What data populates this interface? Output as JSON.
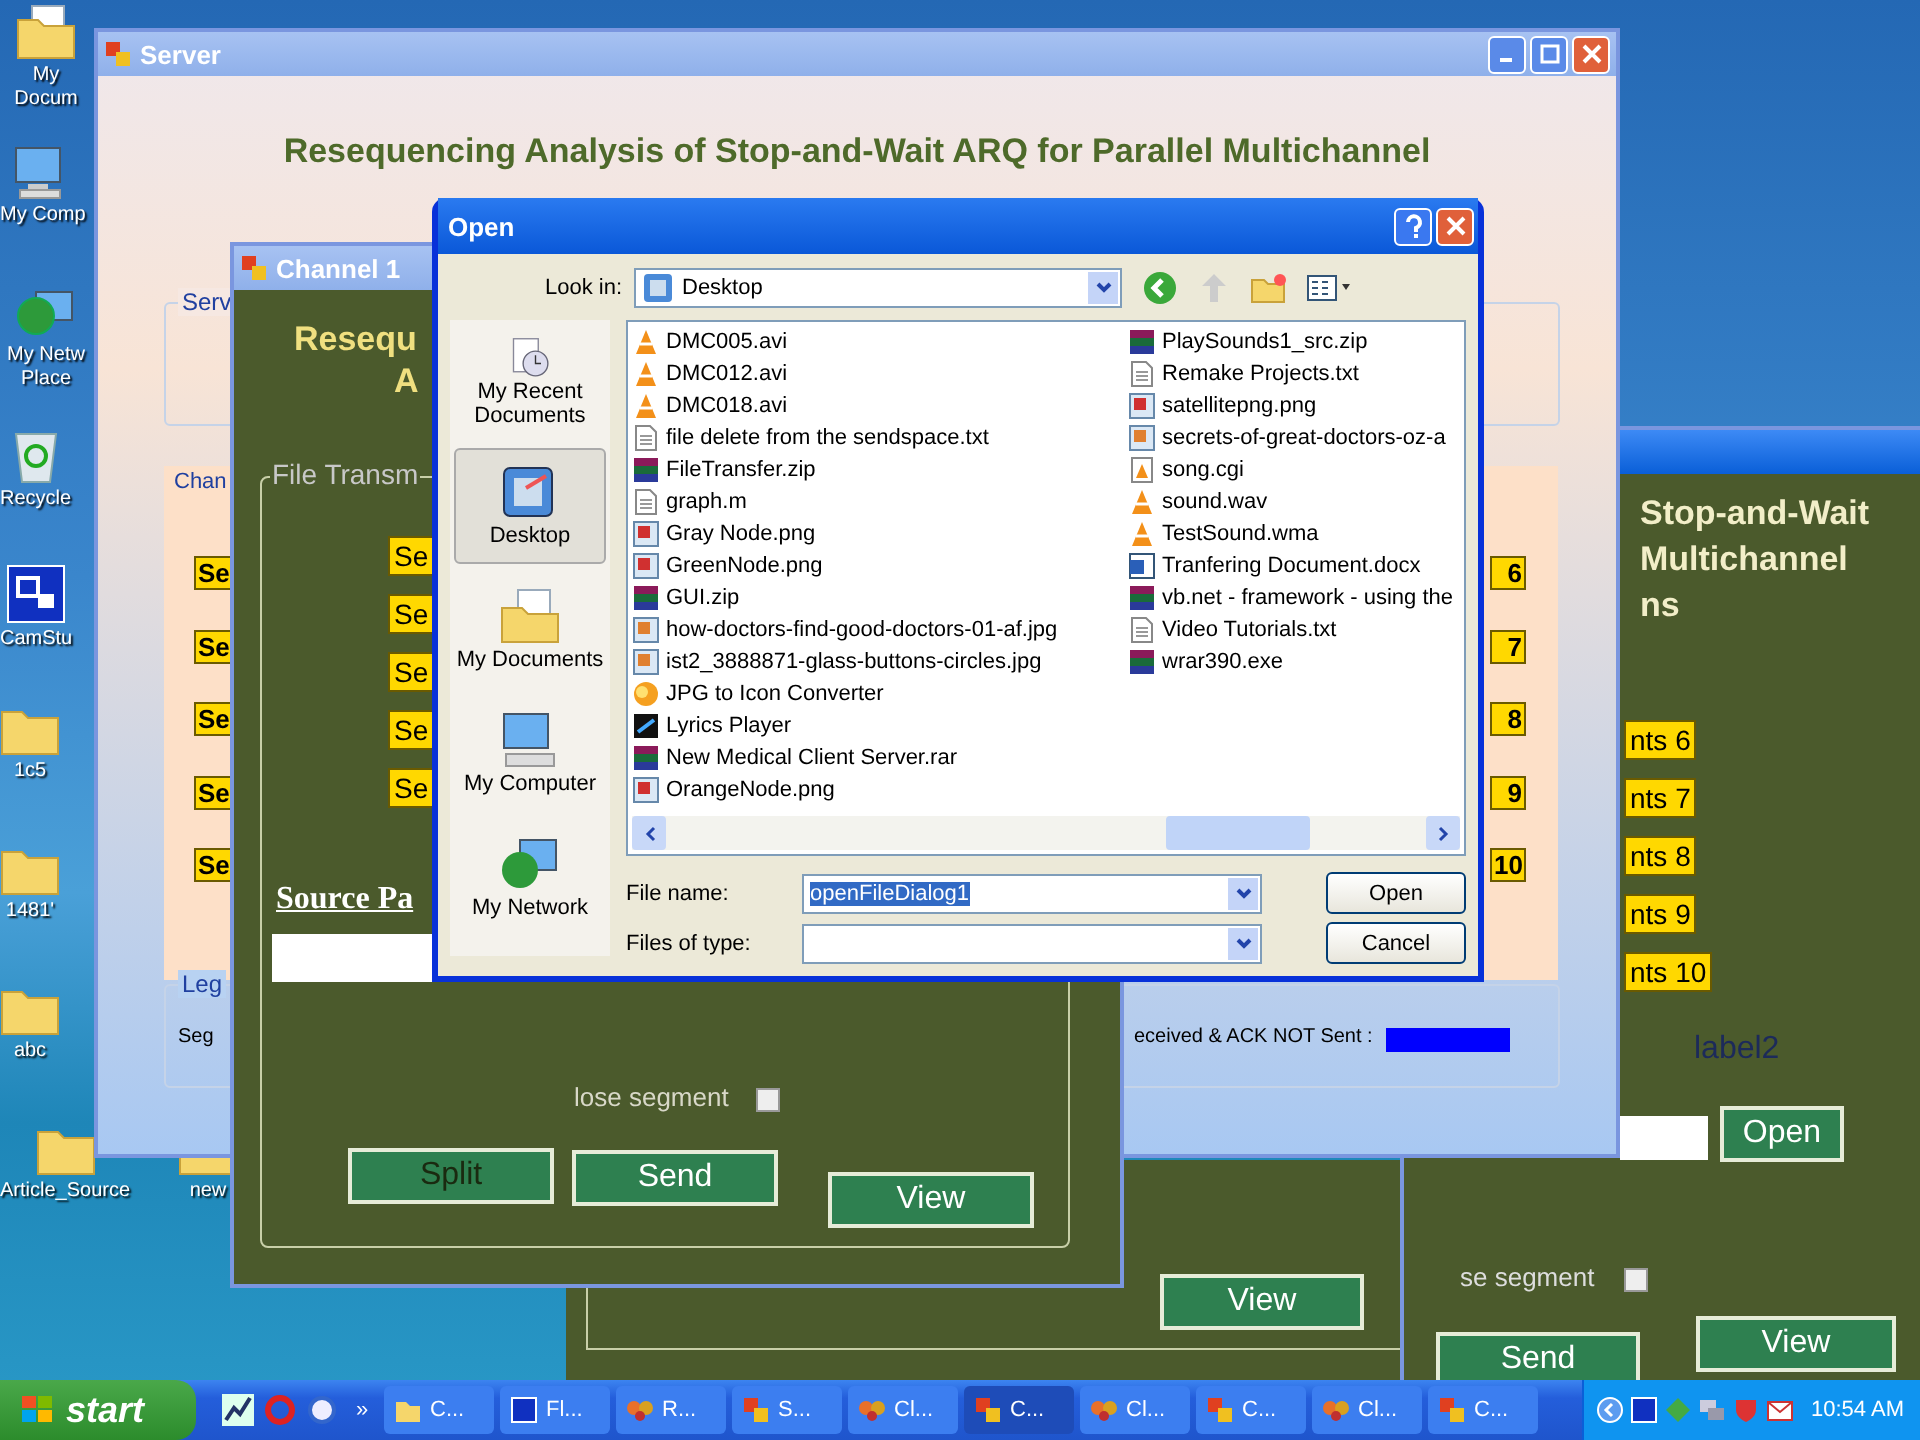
{
  "desktop": {
    "icons": [
      {
        "label": "My Docum",
        "kind": "documents"
      },
      {
        "label": "My Comp",
        "kind": "computer"
      },
      {
        "label": "My Netw Place",
        "kind": "network"
      },
      {
        "label": "Recycle",
        "kind": "recycle"
      },
      {
        "label": "CamStu",
        "kind": "shortcut"
      },
      {
        "label": "1c5",
        "kind": "folder"
      },
      {
        "label": "1481'",
        "kind": "folder"
      },
      {
        "label": "abc",
        "kind": "folder"
      },
      {
        "label": "Article_Source",
        "kind": "folder"
      },
      {
        "label": "new",
        "kind": "folder"
      }
    ]
  },
  "right_window": {
    "heading_lines": [
      "Stop-and-Wait",
      "Multichannel",
      "ns"
    ],
    "segment_labels": [
      "nts 6",
      "nts 7",
      "nts 8",
      "nts 9",
      "nts 10"
    ],
    "label2": "label2",
    "open_button": "Open",
    "lose_segment": {
      "label": "se segment",
      "checked": false
    },
    "buttons": [
      "Send",
      "View"
    ]
  },
  "lower_window": {
    "buttons": [
      "View"
    ]
  },
  "server_window": {
    "title": "Server",
    "heading": "Resequencing Analysis of Stop-and-Wait ARQ for Parallel Multichannel",
    "server_group": {
      "label": "Serv"
    },
    "channels_group": {
      "label": "Chan",
      "left_labels": [
        "Se",
        "Se",
        "Se",
        "Se",
        "Se"
      ],
      "right_labels": [
        "6",
        "7",
        "8",
        "9",
        "10"
      ]
    },
    "legend": {
      "label": "Leg",
      "items": [
        {
          "text": "Seg"
        },
        {
          "text": "eceived & ACK NOT Sent :",
          "color": "#0000ff"
        }
      ]
    }
  },
  "channel_window": {
    "title": "Channel 1",
    "heading_lines": [
      "Resequ",
      "A"
    ],
    "group_label": "File Transm",
    "segment_labels": [
      "Se",
      "Se",
      "Se",
      "Se",
      "Se"
    ],
    "source_label": "Source Pa",
    "lose_segment": {
      "label": "lose segment",
      "checked": false
    },
    "buttons": [
      "Split",
      "Send",
      "View"
    ]
  },
  "open_dialog": {
    "title": "Open",
    "look_in": {
      "label": "Look in:",
      "value": "Desktop"
    },
    "places": [
      {
        "label": "My Recent Documents",
        "kind": "recent",
        "selected": false
      },
      {
        "label": "Desktop",
        "kind": "desktop",
        "selected": true
      },
      {
        "label": "My Documents",
        "kind": "documents",
        "selected": false
      },
      {
        "label": "My Computer",
        "kind": "computer",
        "selected": false
      },
      {
        "label": "My Network",
        "kind": "network",
        "selected": false
      }
    ],
    "files": [
      {
        "name": "DMC005.avi",
        "kind": "video"
      },
      {
        "name": "DMC012.avi",
        "kind": "video"
      },
      {
        "name": "DMC018.avi",
        "kind": "video"
      },
      {
        "name": "file delete from the sendspace.txt",
        "kind": "text"
      },
      {
        "name": "FileTransfer.zip",
        "kind": "archive"
      },
      {
        "name": "graph.m",
        "kind": "file"
      },
      {
        "name": "Gray Node.png",
        "kind": "image"
      },
      {
        "name": "GreenNode.png",
        "kind": "image"
      },
      {
        "name": "GUI.zip",
        "kind": "archive"
      },
      {
        "name": "how-doctors-find-good-doctors-01-af.jpg",
        "kind": "photo"
      },
      {
        "name": "ist2_3888871-glass-buttons-circles.jpg",
        "kind": "photo"
      },
      {
        "name": "JPG to Icon Converter",
        "kind": "app"
      },
      {
        "name": "Lyrics Player",
        "kind": "player"
      },
      {
        "name": "New Medical Client Server.rar",
        "kind": "archive"
      },
      {
        "name": "OrangeNode.png",
        "kind": "image"
      },
      {
        "name": "PlaySounds1_src.zip",
        "kind": "archive"
      },
      {
        "name": "Remake Projects.txt",
        "kind": "text"
      },
      {
        "name": "satellitepng.png",
        "kind": "image"
      },
      {
        "name": "secrets-of-great-doctors-oz-a",
        "kind": "photo"
      },
      {
        "name": "song.cgi",
        "kind": "audio"
      },
      {
        "name": "sound.wav",
        "kind": "video"
      },
      {
        "name": "TestSound.wma",
        "kind": "video"
      },
      {
        "name": "Tranfering Document.docx",
        "kind": "doc"
      },
      {
        "name": "vb.net - framework - using the",
        "kind": "archive"
      },
      {
        "name": "Video Tutorials.txt",
        "kind": "text"
      },
      {
        "name": "wrar390.exe",
        "kind": "archive"
      }
    ],
    "file_name": {
      "label": "File name:",
      "value": "openFileDialog1"
    },
    "file_type": {
      "label": "Files of type:"
    },
    "buttons": [
      "Open",
      "Cancel"
    ]
  },
  "taskbar": {
    "start": "start",
    "more": "»",
    "tasks": [
      {
        "label": "C...",
        "kind": "folder",
        "selected": false
      },
      {
        "label": "Fl...",
        "kind": "app",
        "selected": false
      },
      {
        "label": "R...",
        "kind": "butterfly",
        "selected": false
      },
      {
        "label": "S...",
        "kind": "form",
        "selected": false
      },
      {
        "label": "Cl...",
        "kind": "butterfly",
        "selected": false
      },
      {
        "label": "C...",
        "kind": "form",
        "selected": true
      },
      {
        "label": "Cl...",
        "kind": "butterfly",
        "selected": false
      },
      {
        "label": "C...",
        "kind": "form",
        "selected": false
      },
      {
        "label": "Cl...",
        "kind": "butterfly",
        "selected": false
      },
      {
        "label": "C...",
        "kind": "form",
        "selected": false
      }
    ],
    "clock": "10:54 AM"
  }
}
